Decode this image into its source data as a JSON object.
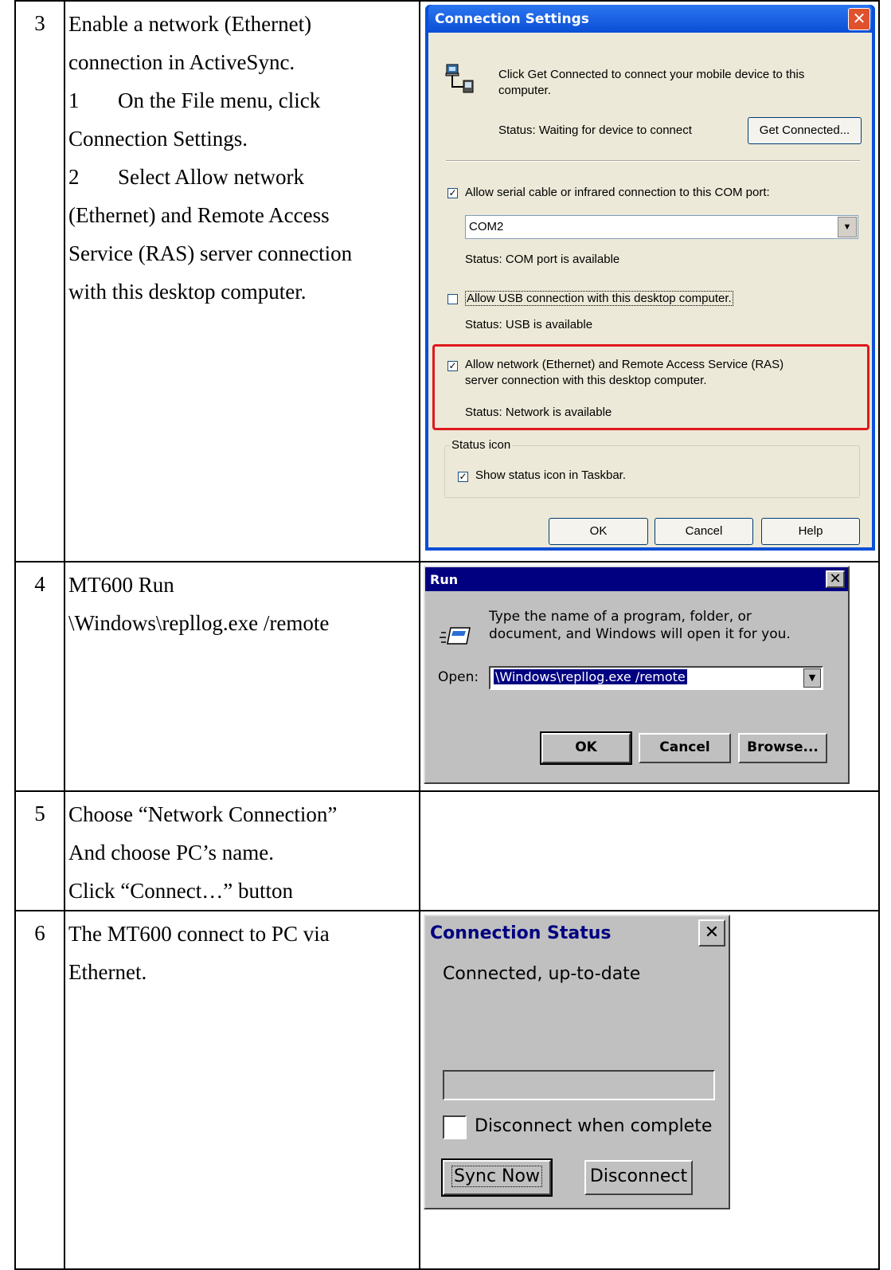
{
  "rows": [
    {
      "num": "3",
      "lines": [
        "Enable a network (Ethernet)",
        "connection in ActiveSync."
      ],
      "sub": [
        {
          "n": "1",
          "text": "On the File menu, click"
        },
        {
          "text": "Connection Settings."
        },
        {
          "n": "2",
          "text": "Select Allow network"
        },
        {
          "text": "(Ethernet) and Remote Access"
        },
        {
          "text": "Service (RAS) server connection"
        },
        {
          "text": "with this desktop computer."
        }
      ]
    },
    {
      "num": "4",
      "lines": [
        "MT600 Run",
        "\\Windows\\repllog.exe /remote"
      ]
    },
    {
      "num": "5",
      "lines": [
        "Choose “Network Connection”",
        "And choose PC’s name.",
        "Click “Connect…” button"
      ]
    },
    {
      "num": "6",
      "lines": [
        "The MT600 connect to PC via",
        "Ethernet."
      ]
    }
  ],
  "connection_settings": {
    "title": "Connection Settings",
    "intro_line1": "Click Get Connected to connect your mobile device to this",
    "intro_line2": "computer.",
    "status_waiting": "Status: Waiting for device to connect",
    "get_connected": "Get Connected...",
    "serial_label": "Allow serial cable or infrared connection to this COM port:",
    "serial_checked": true,
    "com_port": "COM2",
    "com_status": "Status:   COM port is available",
    "usb_label": "Allow USB connection with this desktop computer.",
    "usb_checked": false,
    "usb_status": "Status:   USB is available",
    "network_label_line1": "Allow network (Ethernet) and Remote Access Service (RAS)",
    "network_label_line2": "server connection with this desktop computer.",
    "network_checked": true,
    "network_status": "Status:   Network is available",
    "status_icon_group": "Status icon",
    "show_icon_label": "Show status icon in Taskbar.",
    "show_icon_checked": true,
    "ok": "OK",
    "cancel": "Cancel",
    "help": "Help"
  },
  "run_dialog": {
    "title": "Run",
    "description_line1": "Type the name of a program, folder, or",
    "description_line2": "document, and Windows will open it for you.",
    "open_label": "Open:",
    "open_value": "\\Windows\\repllog.exe /remote",
    "ok": "OK",
    "cancel": "Cancel",
    "browse": "Browse..."
  },
  "connection_status": {
    "title": "Connection Status",
    "status_text": "Connected, up-to-date",
    "progress": 0,
    "disconnect_label": "Disconnect when complete",
    "disconnect_checked": false,
    "sync_now": "Sync Now",
    "disconnect": "Disconnect"
  }
}
